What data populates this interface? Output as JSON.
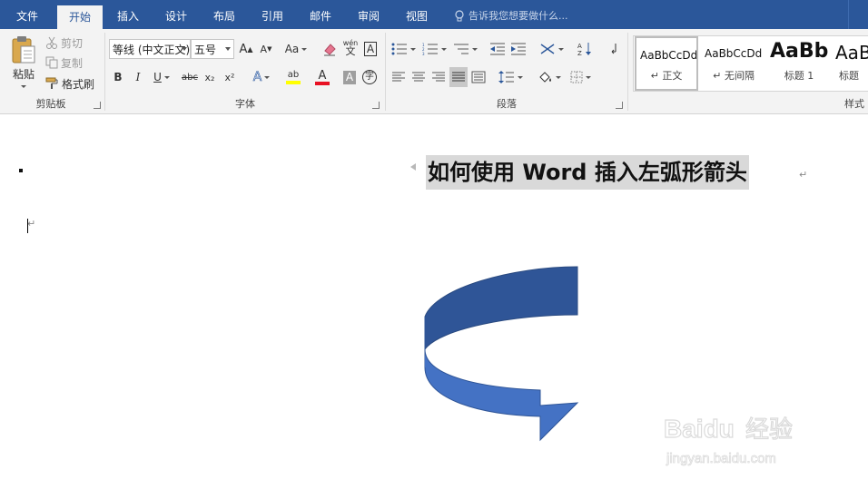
{
  "tabs": [
    "文件",
    "开始",
    "插入",
    "设计",
    "布局",
    "引用",
    "邮件",
    "审阅",
    "视图"
  ],
  "active_tab": "开始",
  "tell_me": "告诉我您想要做什么...",
  "clipboard": {
    "paste_label": "粘贴",
    "cut_label": "剪切",
    "copy_label": "复制",
    "format_painter_label": "格式刷",
    "group_label": "剪贴板"
  },
  "font": {
    "font_name": "等线 (中文正文)",
    "font_size": "五号",
    "grow_label": "A",
    "shrink_label": "A",
    "change_case_label": "Aa",
    "phonetic_label": "wén",
    "phonetic_char": "文",
    "border_label": "A",
    "bold": "B",
    "italic": "I",
    "underline": "U",
    "strike": "abc",
    "subscript": "x₂",
    "superscript": "x²",
    "text_effect": "A",
    "highlight": "ab",
    "font_color": "A",
    "shading": "A",
    "enclose": "字",
    "group_label": "字体",
    "highlight_color": "#ffff00",
    "font_color_value": "#e81123"
  },
  "paragraph": {
    "group_label": "段落"
  },
  "styles": {
    "items": [
      {
        "preview": "AaBbCcDd",
        "name": "正文"
      },
      {
        "preview": "AaBbCcDd",
        "name": "无间隔"
      },
      {
        "preview": "AaBb",
        "name": "标题 1"
      },
      {
        "preview": "AaBb",
        "name": "标题"
      }
    ],
    "group_label": "样式"
  },
  "document": {
    "heading": "如何使用 Word 插入左弧形箭头",
    "paragraph_mark": "↵",
    "arrow_color_dark": "#2f5597",
    "arrow_color_light": "#4472c4"
  },
  "watermark": {
    "brand": "Baidu经验",
    "url": "jingyan.baidu.com"
  },
  "colors": {
    "accent": "#2b579a",
    "ribbon_bg": "#f3f3f3"
  }
}
